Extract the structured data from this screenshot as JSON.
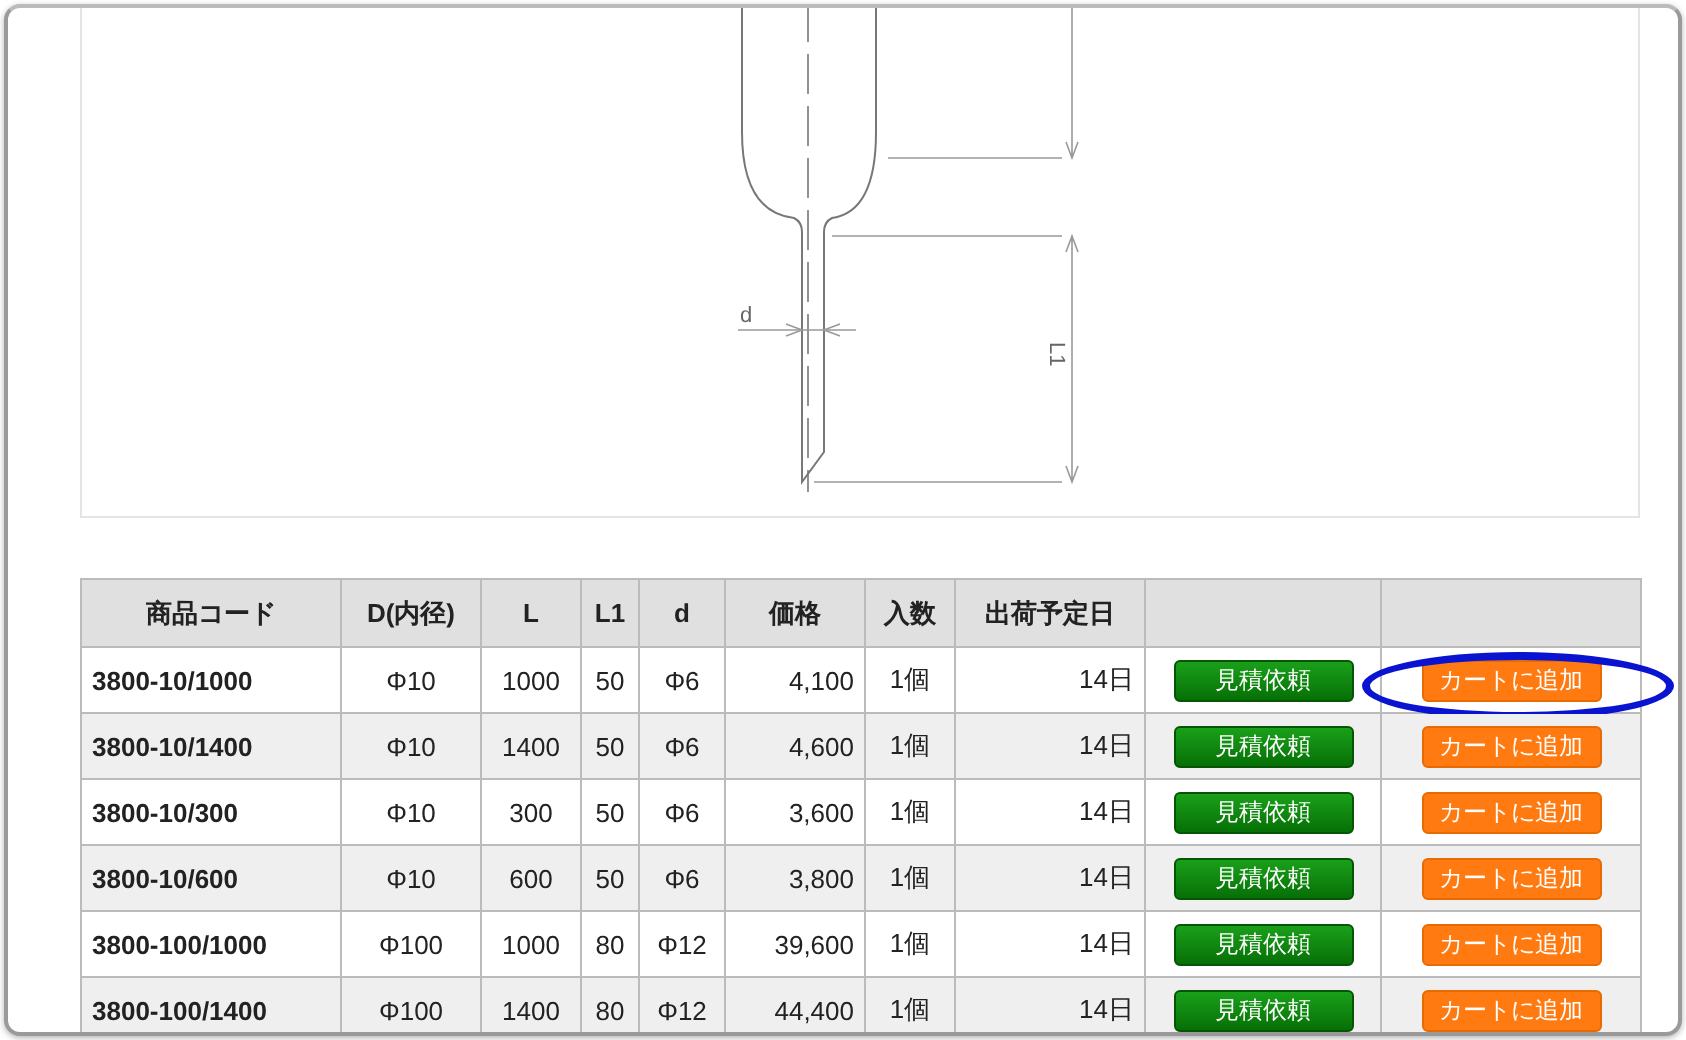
{
  "diagram": {
    "labels": [
      "d",
      "L1"
    ]
  },
  "table": {
    "columns": [
      "商品コード",
      "D(内径)",
      "L",
      "L1",
      "d",
      "価格",
      "入数",
      "出荷予定日",
      "",
      ""
    ],
    "rows": [
      {
        "code": "3800-10/1000",
        "diameter": "Φ10",
        "L": "1000",
        "L1": "50",
        "d": "Φ6",
        "price": "4,100",
        "qty": "1個",
        "ship": "14日",
        "quote": "見積依頼",
        "cart": "カートに追加",
        "circled": true
      },
      {
        "code": "3800-10/1400",
        "diameter": "Φ10",
        "L": "1400",
        "L1": "50",
        "d": "Φ6",
        "price": "4,600",
        "qty": "1個",
        "ship": "14日",
        "quote": "見積依頼",
        "cart": "カートに追加",
        "circled": false
      },
      {
        "code": "3800-10/300",
        "diameter": "Φ10",
        "L": "300",
        "L1": "50",
        "d": "Φ6",
        "price": "3,600",
        "qty": "1個",
        "ship": "14日",
        "quote": "見積依頼",
        "cart": "カートに追加",
        "circled": false
      },
      {
        "code": "3800-10/600",
        "diameter": "Φ10",
        "L": "600",
        "L1": "50",
        "d": "Φ6",
        "price": "3,800",
        "qty": "1個",
        "ship": "14日",
        "quote": "見積依頼",
        "cart": "カートに追加",
        "circled": false
      },
      {
        "code": "3800-100/1000",
        "diameter": "Φ100",
        "L": "1000",
        "L1": "80",
        "d": "Φ12",
        "price": "39,600",
        "qty": "1個",
        "ship": "14日",
        "quote": "見積依頼",
        "cart": "カートに追加",
        "circled": false
      },
      {
        "code": "3800-100/1400",
        "diameter": "Φ100",
        "L": "1400",
        "L1": "80",
        "d": "Φ12",
        "price": "44,400",
        "qty": "1個",
        "ship": "14日",
        "quote": "見積依頼",
        "cart": "カートに追加",
        "circled": false
      }
    ]
  }
}
